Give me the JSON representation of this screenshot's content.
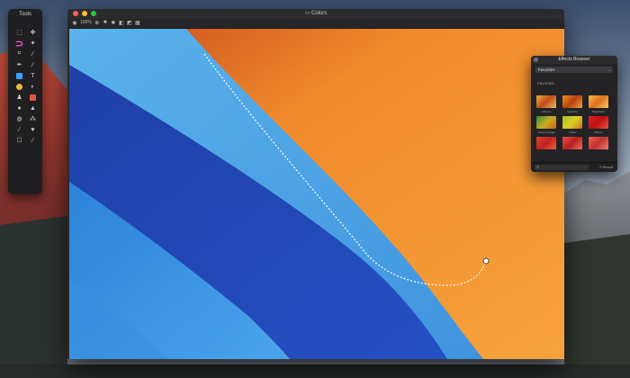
{
  "window": {
    "title": "Colors",
    "traffic_colors": [
      "#ff5f57",
      "#febc2e",
      "#28c840"
    ]
  },
  "toolbar": {
    "zoom_label": "100%",
    "icons": [
      "navigate-icon",
      "zoom-icon",
      "layers-icon",
      "adjust-icon",
      "export-icon",
      "share-icon",
      "settings-icon"
    ]
  },
  "tools_panel": {
    "title": "Tools",
    "active_tool": "magnet-selection-icon"
  },
  "effects_browser": {
    "title": "Effects Browser",
    "dropdown": "Favorites",
    "category": "Favorites",
    "effects": [
      "Chrome",
      "Sapphire",
      "Brightness",
      "Yellow Orange",
      "Yellow",
      "Mimics",
      "",
      "",
      ""
    ],
    "search_placeholder": "",
    "count": "9 Result"
  }
}
